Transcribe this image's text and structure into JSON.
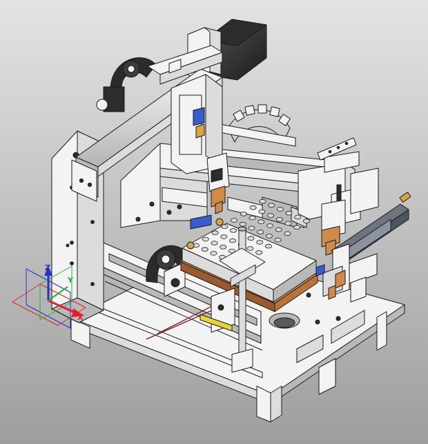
{
  "viewport": {
    "background_top": "#e3e3e3",
    "background_bottom": "#9e9e9e"
  },
  "model": {
    "part_white": "#f3f3f3",
    "part_light": "#dcdcdc",
    "part_mid": "#b9b9b9",
    "part_dark": "#2d2d2d",
    "edge": "#1a1a1a",
    "copper": "#d08a4c",
    "copper_dark": "#9a5c2c",
    "blue_block": "#3a5bd0",
    "gold": "#d9a441",
    "yellow": "#e8d23a",
    "steel_dark": "#6f7580",
    "section_line": "#7a1f1f"
  },
  "triad": {
    "x_label": "X",
    "y_label": "Y",
    "z_label": "Z",
    "x_color": "#e0202a",
    "y_color": "#1fb33a",
    "z_color": "#2233cc"
  }
}
